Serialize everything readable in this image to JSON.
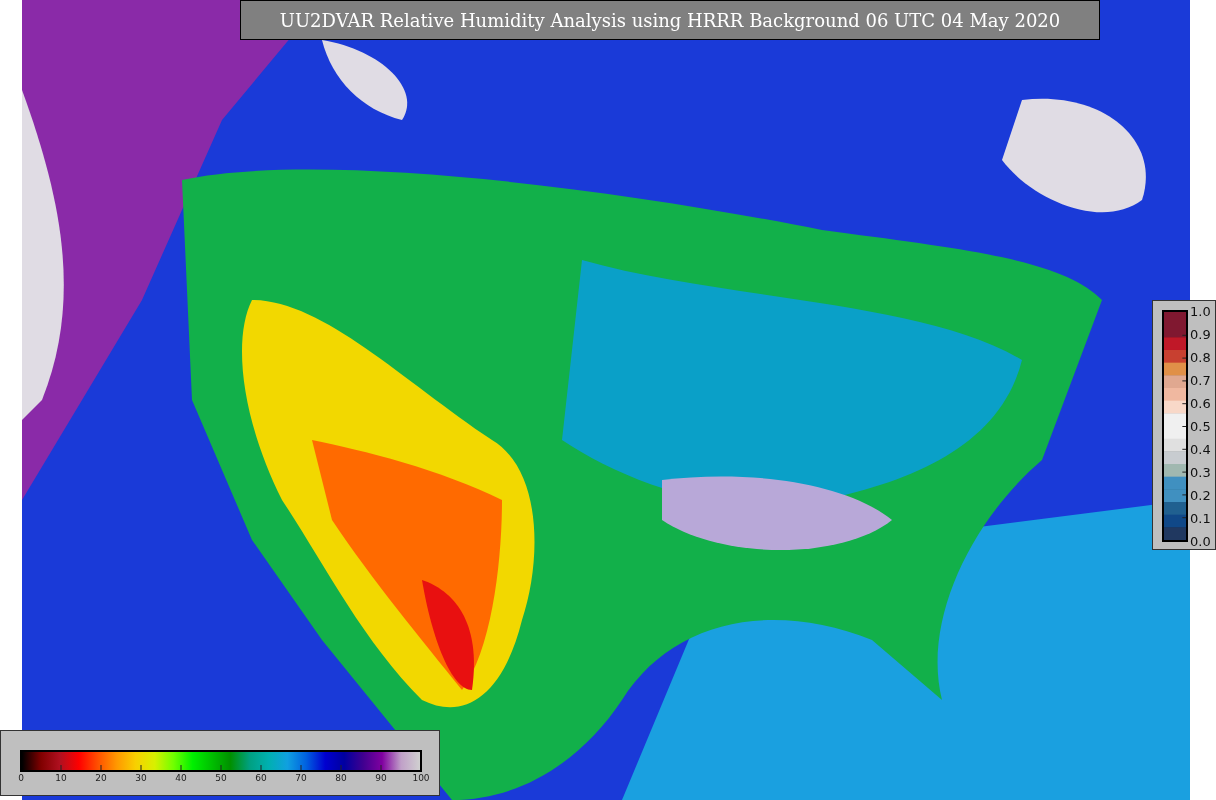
{
  "title": "UU2DVAR Relative Humidity Analysis using HRRR Background 06 UTC 04 May 2020",
  "horizontal_colorbar": {
    "ticks": [
      "0",
      "10",
      "20",
      "30",
      "40",
      "50",
      "60",
      "70",
      "80",
      "90",
      "100"
    ]
  },
  "vertical_colorbar": {
    "ticks": [
      "1.0",
      "0.9",
      "0.8",
      "0.7",
      "0.6",
      "0.5",
      "0.4",
      "0.3",
      "0.2",
      "0.1",
      "0.0"
    ]
  }
}
